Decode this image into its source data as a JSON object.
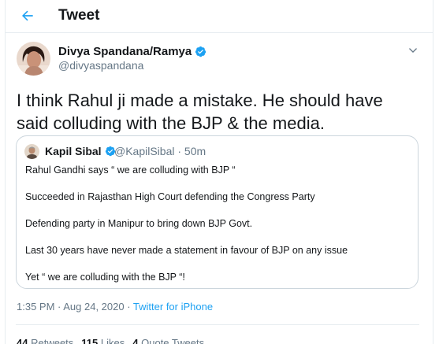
{
  "header": {
    "title": "Tweet",
    "back_icon": "arrow-left-icon"
  },
  "tweet": {
    "author_name": "Divya Spandana/Ramya",
    "author_handle": "@divyaspandana",
    "text": "I think Rahul ji made a mistake. He should have said colluding with the BJP & the media.",
    "time": "1:35 PM · Aug 24, 2020 · ",
    "source": "Twitter for iPhone"
  },
  "quote": {
    "author_name": "Kapil Sibal",
    "author_handle": "@KapilSibal · 50m",
    "lines": [
      "Rahul Gandhi says “ we are colluding with BJP “",
      "Succeeded in Rajasthan High Court defending the Congress Party",
      "Defending party in Manipur to bring down BJP Govt.",
      "Last 30 years have never made a statement in favour of BJP on any issue",
      "Yet “ we are colluding with the BJP “!"
    ]
  },
  "stats": {
    "retweets_count": "44",
    "retweets_label": "Retweets",
    "likes_count": "115",
    "likes_label": "Likes",
    "quotes_count": "4",
    "quotes_label": "Quote Tweets"
  },
  "colors": {
    "accent": "#1da1f2",
    "secondary_text": "#657786",
    "border": "#e6ecf0"
  }
}
